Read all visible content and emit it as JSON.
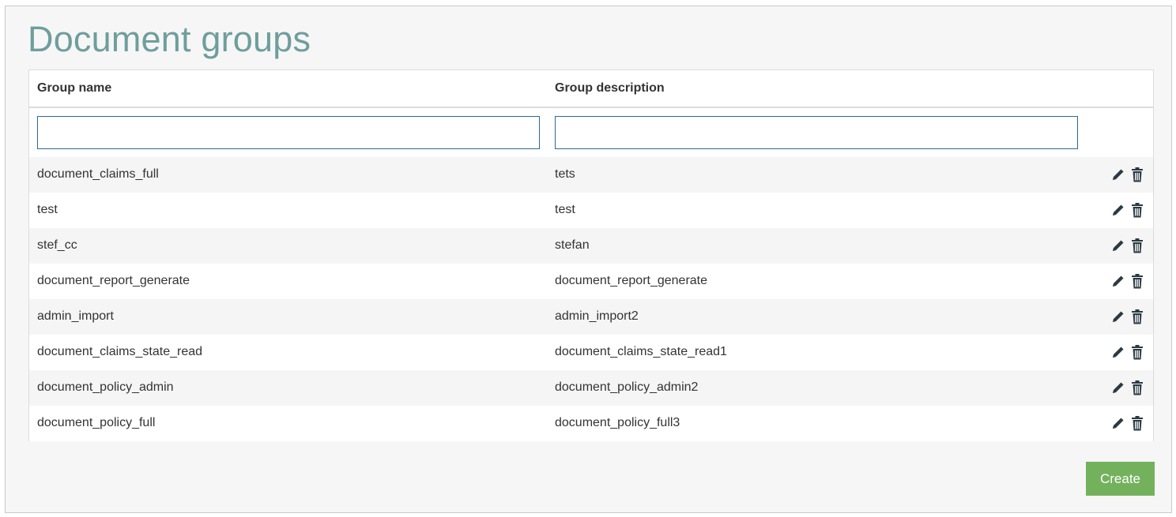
{
  "page": {
    "title": "Document groups"
  },
  "table": {
    "headers": {
      "name": "Group name",
      "description": "Group description"
    },
    "filters": {
      "name_value": "",
      "description_value": ""
    },
    "rows": [
      {
        "name": "document_claims_full",
        "description": "tets"
      },
      {
        "name": "test",
        "description": "test"
      },
      {
        "name": "stef_cc",
        "description": "stefan"
      },
      {
        "name": "document_report_generate",
        "description": "document_report_generate"
      },
      {
        "name": "admin_import",
        "description": "admin_import2"
      },
      {
        "name": "document_claims_state_read",
        "description": "document_claims_state_read1"
      },
      {
        "name": "document_policy_admin",
        "description": "document_policy_admin2"
      },
      {
        "name": "document_policy_full",
        "description": "document_policy_full3"
      }
    ],
    "row_actions": {
      "edit_icon": "pencil-icon",
      "delete_icon": "trash-icon"
    }
  },
  "footer": {
    "create_label": "Create"
  },
  "colors": {
    "title": "#6f9e9c",
    "create_button": "#74b15c",
    "filter_border": "#2e6a8c",
    "icon": "#2b3a42"
  }
}
